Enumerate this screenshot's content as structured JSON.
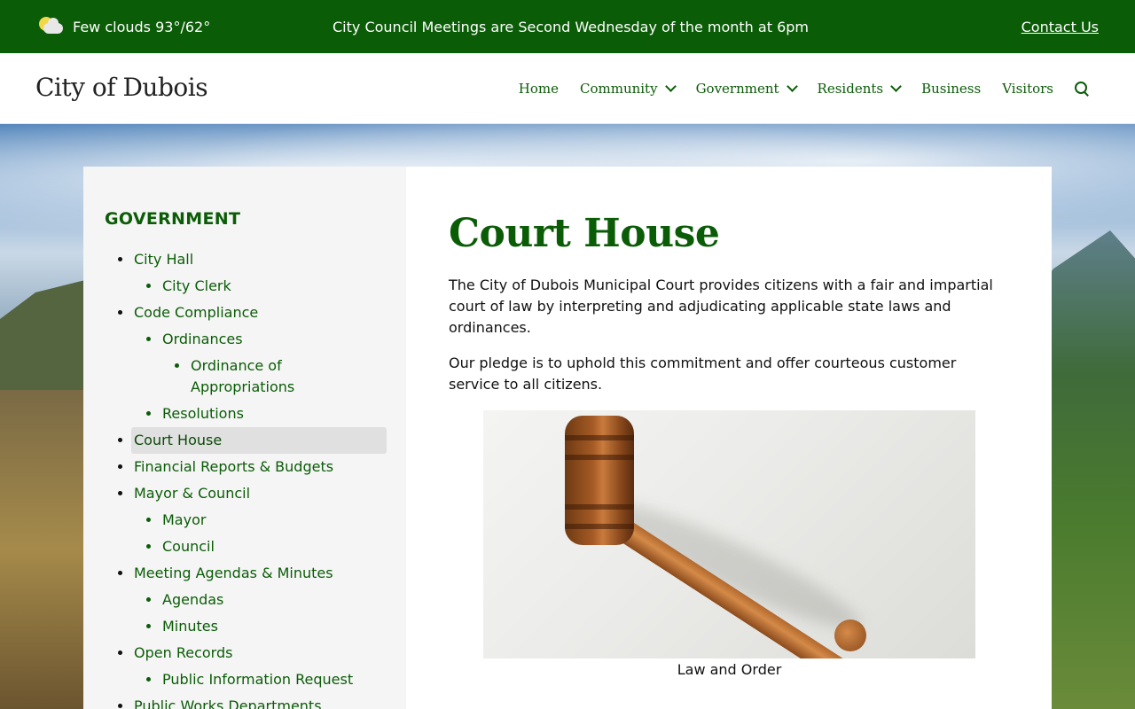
{
  "topbar": {
    "weather_text": "Few clouds 93°/62°",
    "weather_icon": "partly-cloudy-icon",
    "announcement": "City Council Meetings are Second Wednesday of the month at 6pm",
    "contact_label": "Contact Us"
  },
  "header": {
    "site_title": "City of Dubois",
    "nav": [
      {
        "label": "Home",
        "dropdown": false
      },
      {
        "label": "Community",
        "dropdown": true
      },
      {
        "label": "Government",
        "dropdown": true
      },
      {
        "label": "Residents",
        "dropdown": true
      },
      {
        "label": "Business",
        "dropdown": false
      },
      {
        "label": "Visitors",
        "dropdown": false
      }
    ],
    "search_icon": "search-icon"
  },
  "sidebar": {
    "heading": "GOVERNMENT",
    "items": [
      {
        "label": "City Hall",
        "level": 1
      },
      {
        "label": "City Clerk",
        "level": 2
      },
      {
        "label": "Code Compliance",
        "level": 1
      },
      {
        "label": "Ordinances",
        "level": 2
      },
      {
        "label": "Ordinance of Appropriations",
        "level": 3
      },
      {
        "label": "Resolutions",
        "level": 2
      },
      {
        "label": "Court House",
        "level": 1,
        "active": true
      },
      {
        "label": "Financial Reports & Budgets",
        "level": 1
      },
      {
        "label": "Mayor & Council",
        "level": 1
      },
      {
        "label": "Mayor",
        "level": 2
      },
      {
        "label": "Council",
        "level": 2
      },
      {
        "label": "Meeting Agendas & Minutes",
        "level": 1
      },
      {
        "label": "Agendas",
        "level": 2
      },
      {
        "label": "Minutes",
        "level": 2
      },
      {
        "label": "Open Records",
        "level": 1
      },
      {
        "label": "Public Information Request",
        "level": 2
      },
      {
        "label": "Public Works Departments",
        "level": 1
      }
    ]
  },
  "main": {
    "title": "Court House",
    "paragraphs": [
      "The City of Dubois Municipal Court provides citizens with a fair and impartial court of law by interpreting and adjudicating applicable state laws and ordinances.",
      "Our pledge is to uphold this commitment and offer courteous customer service to all citizens."
    ],
    "figure_caption": "Law and Order"
  },
  "colors": {
    "brand_green": "#0b5c07",
    "sidebar_bg": "#f5f5f5",
    "active_bg": "#e0e0e0"
  }
}
